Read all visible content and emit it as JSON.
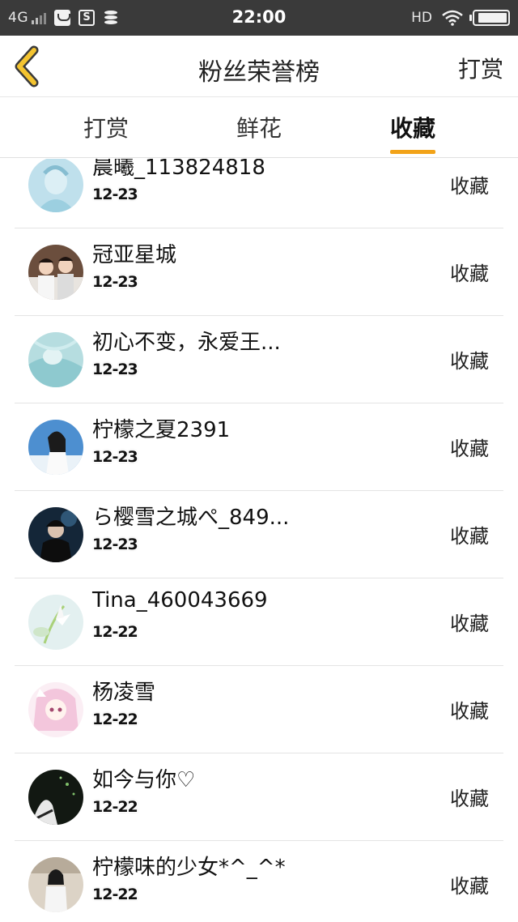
{
  "status_bar": {
    "network": "4G",
    "time": "22:00",
    "hd": "HD",
    "battery_level": 0.93
  },
  "header": {
    "title": "粉丝荣誉榜",
    "action_label": "打赏"
  },
  "tabs": [
    {
      "label": "打赏",
      "active": false
    },
    {
      "label": "鲜花",
      "active": false
    },
    {
      "label": "收藏",
      "active": true
    }
  ],
  "colors": {
    "accent": "#f2a319",
    "status_bar_bg": "#3a3a3a",
    "divider": "#e4e4e4"
  },
  "list": [
    {
      "name": "晨曦_113824818",
      "date": "12-23",
      "action": "收藏"
    },
    {
      "name": "冠亚星城",
      "date": "12-23",
      "action": "收藏"
    },
    {
      "name": "初心不变，永爱王...",
      "date": "12-23",
      "action": "收藏"
    },
    {
      "name": "柠檬之夏2391",
      "date": "12-23",
      "action": "收藏"
    },
    {
      "name": "ら樱雪之城ぺ_849...",
      "date": "12-23",
      "action": "收藏"
    },
    {
      "name": "Tina_460043669",
      "date": "12-22",
      "action": "收藏"
    },
    {
      "name": "杨凌雪",
      "date": "12-22",
      "action": "收藏"
    },
    {
      "name": "如今与你♡",
      "date": "12-22",
      "action": "收藏"
    },
    {
      "name": "柠檬味的少女*^_^*",
      "date": "12-22",
      "action": "收藏"
    }
  ]
}
